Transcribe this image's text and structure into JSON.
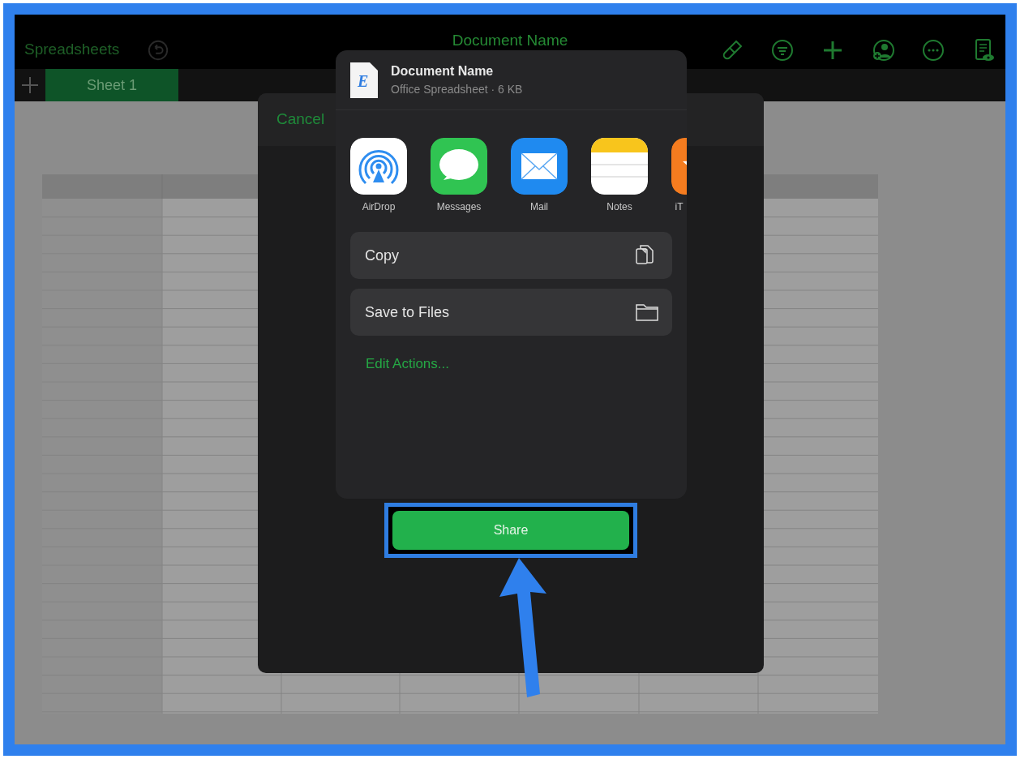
{
  "toolbar": {
    "back_label": "Spreadsheets",
    "title": "Document Name"
  },
  "sheet_tabs": [
    {
      "label": "Sheet 1",
      "selected": true
    }
  ],
  "dialog": {
    "cancel_label": "Cancel",
    "share_button": "Share"
  },
  "share_sheet": {
    "file_icon_letter": "E",
    "file_name": "Document Name",
    "file_info": "Office Spreadsheet · 6 KB",
    "apps": [
      {
        "label": "AirDrop",
        "kind": "airdrop"
      },
      {
        "label": "Messages",
        "kind": "messages"
      },
      {
        "label": "Mail",
        "kind": "mail"
      },
      {
        "label": "Notes",
        "kind": "notes"
      },
      {
        "label": "iT",
        "kind": "itunes"
      }
    ],
    "actions": [
      {
        "label": "Copy",
        "kind": "copy"
      },
      {
        "label": "Save to Files",
        "kind": "folder"
      }
    ],
    "edit_actions": "Edit Actions..."
  }
}
